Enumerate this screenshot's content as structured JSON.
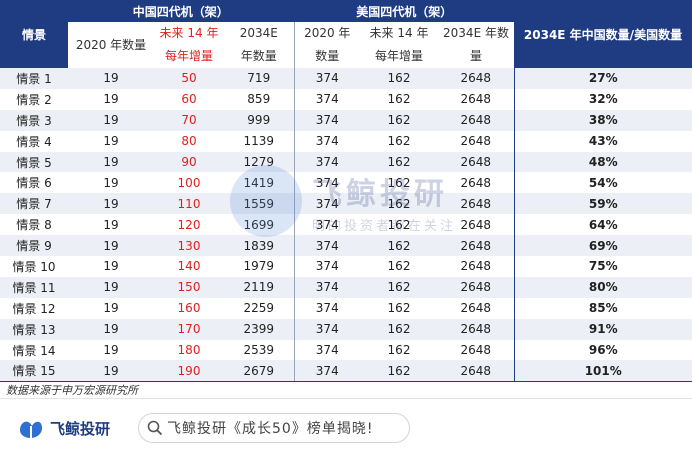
{
  "table": {
    "group_china": "中国四代机（架）",
    "group_us": "美国四代机（架）",
    "col_scenario": "情景",
    "col_ratio": "2034E 年中国数量/美国数量",
    "sub": {
      "cn_2020": "2020 年数量",
      "cn_inc_l1": "未来 14 年",
      "cn_inc_l2": "每年增量",
      "cn_2034_l1": "2034E",
      "cn_2034_l2": "年数量",
      "us_2020_l1": "2020 年",
      "us_2020_l2": "数量",
      "us_inc_l1": "未来 14 年",
      "us_inc_l2": "每年增量",
      "us_2034_l1": "2034E 年数",
      "us_2034_l2": "量"
    },
    "rows": [
      {
        "s": "情景 1",
        "cn2020": "19",
        "inc": "50",
        "cn2034": "719",
        "us2020": "374",
        "usinc": "162",
        "us2034": "2648",
        "ratio": "27%"
      },
      {
        "s": "情景 2",
        "cn2020": "19",
        "inc": "60",
        "cn2034": "859",
        "us2020": "374",
        "usinc": "162",
        "us2034": "2648",
        "ratio": "32%"
      },
      {
        "s": "情景 3",
        "cn2020": "19",
        "inc": "70",
        "cn2034": "999",
        "us2020": "374",
        "usinc": "162",
        "us2034": "2648",
        "ratio": "38%"
      },
      {
        "s": "情景 4",
        "cn2020": "19",
        "inc": "80",
        "cn2034": "1139",
        "us2020": "374",
        "usinc": "162",
        "us2034": "2648",
        "ratio": "43%"
      },
      {
        "s": "情景 5",
        "cn2020": "19",
        "inc": "90",
        "cn2034": "1279",
        "us2020": "374",
        "usinc": "162",
        "us2034": "2648",
        "ratio": "48%"
      },
      {
        "s": "情景 6",
        "cn2020": "19",
        "inc": "100",
        "cn2034": "1419",
        "us2020": "374",
        "usinc": "162",
        "us2034": "2648",
        "ratio": "54%"
      },
      {
        "s": "情景 7",
        "cn2020": "19",
        "inc": "110",
        "cn2034": "1559",
        "us2020": "374",
        "usinc": "162",
        "us2034": "2648",
        "ratio": "59%"
      },
      {
        "s": "情景 8",
        "cn2020": "19",
        "inc": "120",
        "cn2034": "1699",
        "us2020": "374",
        "usinc": "162",
        "us2034": "2648",
        "ratio": "64%"
      },
      {
        "s": "情景 9",
        "cn2020": "19",
        "inc": "130",
        "cn2034": "1839",
        "us2020": "374",
        "usinc": "162",
        "us2034": "2648",
        "ratio": "69%"
      },
      {
        "s": "情景 10",
        "cn2020": "19",
        "inc": "140",
        "cn2034": "1979",
        "us2020": "374",
        "usinc": "162",
        "us2034": "2648",
        "ratio": "75%"
      },
      {
        "s": "情景 11",
        "cn2020": "19",
        "inc": "150",
        "cn2034": "2119",
        "us2020": "374",
        "usinc": "162",
        "us2034": "2648",
        "ratio": "80%"
      },
      {
        "s": "情景 12",
        "cn2020": "19",
        "inc": "160",
        "cn2034": "2259",
        "us2020": "374",
        "usinc": "162",
        "us2034": "2648",
        "ratio": "85%"
      },
      {
        "s": "情景 13",
        "cn2020": "19",
        "inc": "170",
        "cn2034": "2399",
        "us2020": "374",
        "usinc": "162",
        "us2034": "2648",
        "ratio": "91%"
      },
      {
        "s": "情景 14",
        "cn2020": "19",
        "inc": "180",
        "cn2034": "2539",
        "us2020": "374",
        "usinc": "162",
        "us2034": "2648",
        "ratio": "96%"
      },
      {
        "s": "情景 15",
        "cn2020": "19",
        "inc": "190",
        "cn2034": "2679",
        "us2020": "374",
        "usinc": "162",
        "us2034": "2648",
        "ratio": "101%"
      }
    ]
  },
  "source": "数据来源于申万宏源研究所",
  "watermark": {
    "big": "飞鲸投研",
    "small": "明的投资者都在关注"
  },
  "footer": {
    "logo_text": "飞鲸投研",
    "search_text": "飞鲸投研《成长50》榜单揭晓!"
  },
  "colors": {
    "header": "#1f3c82",
    "accent_red": "#e02020",
    "stripe": "#eceff5"
  },
  "icons": {
    "logo": "whale-logo-icon",
    "search": "search-icon"
  }
}
